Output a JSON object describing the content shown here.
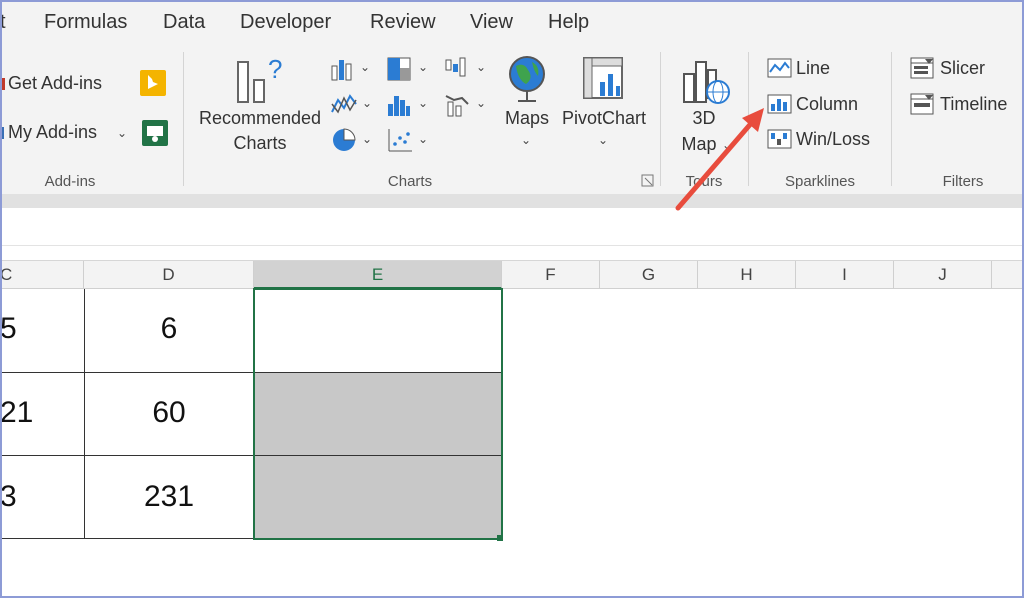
{
  "tabs": [
    "t",
    "Formulas",
    "Data",
    "Developer",
    "Review",
    "View",
    "Help"
  ],
  "addins": {
    "get_addins": "Get Add-ins",
    "my_addins": "My Add-ins",
    "group_label": "Add-ins"
  },
  "charts": {
    "recommended_line1": "Recommended",
    "recommended_line2": "Charts",
    "maps": "Maps",
    "pivotchart": "PivotChart",
    "group_label": "Charts"
  },
  "tours": {
    "map_line1": "3D",
    "map_line2": "Map",
    "group_label": "Tours"
  },
  "sparklines": {
    "line": "Line",
    "column": "Column",
    "winloss": "Win/Loss",
    "group_label": "Sparklines"
  },
  "filters": {
    "slicer": "Slicer",
    "timeline": "Timeline",
    "group_label": "Filters"
  },
  "columns": [
    "C",
    "D",
    "E",
    "F",
    "G",
    "H",
    "I",
    "J"
  ],
  "grid": {
    "col_c": [
      "5",
      "21",
      "3"
    ],
    "col_d": [
      "6",
      "60",
      "231"
    ]
  },
  "colors": {
    "accent_green": "#217346",
    "arrow_red": "#e84c3d",
    "chart_blue": "#2b7cd3"
  }
}
